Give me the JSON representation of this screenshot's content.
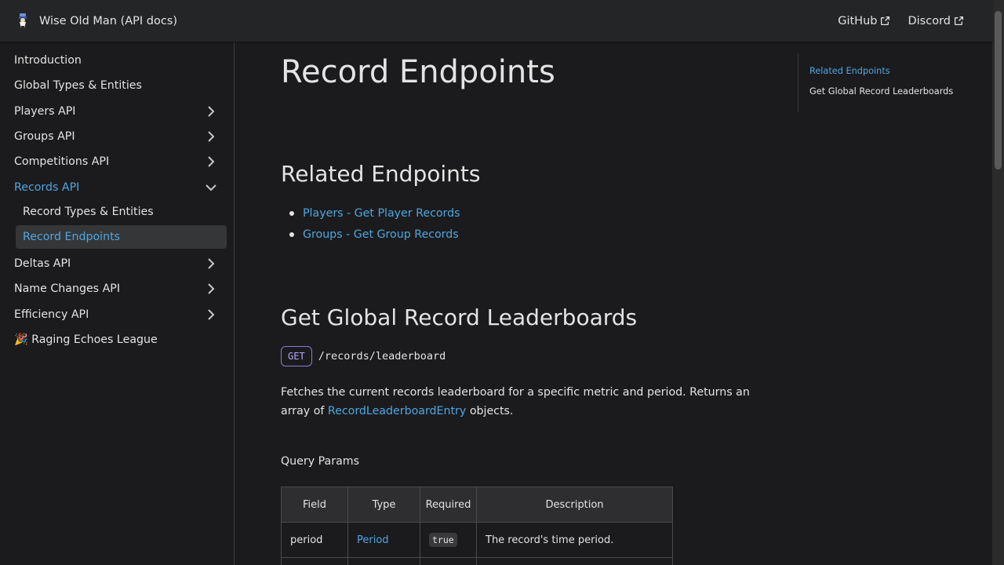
{
  "navbar": {
    "title": "Wise Old Man (API docs)",
    "links": [
      {
        "label": "GitHub",
        "icon": "external-link-icon"
      },
      {
        "label": "Discord",
        "icon": "external-link-icon"
      }
    ]
  },
  "sidebar": {
    "items": [
      {
        "label": "Introduction"
      },
      {
        "label": "Global Types & Entities"
      },
      {
        "label": "Players API",
        "icon": "chevron-right-icon"
      },
      {
        "label": "Groups API",
        "icon": "chevron-right-icon"
      },
      {
        "label": "Competitions API",
        "icon": "chevron-right-icon"
      },
      {
        "label": "Records API",
        "icon": "chevron-down-icon",
        "active": true
      },
      {
        "label": "Deltas API",
        "icon": "chevron-right-icon"
      },
      {
        "label": "Name Changes API",
        "icon": "chevron-right-icon"
      },
      {
        "label": "Efficiency API",
        "icon": "chevron-right-icon"
      },
      {
        "label": "🎉 Raging Echoes League"
      }
    ],
    "records_sub": [
      {
        "label": "Record Types & Entities"
      },
      {
        "label": "Record Endpoints",
        "current": true
      }
    ]
  },
  "main": {
    "title": "Record Endpoints",
    "related_heading": "Related Endpoints",
    "related_links": [
      {
        "label": "Players - Get Player Records"
      },
      {
        "label": "Groups - Get Group Records"
      }
    ],
    "endpoint_heading": "Get Global Record Leaderboards",
    "method": "GET",
    "path": "/records/leaderboard",
    "description_pre": "Fetches the current records leaderboard for a specific metric and period. Returns an array of",
    "description_link": "RecordLeaderboardEntry",
    "description_post": "objects.",
    "query_params_title": "Query Params",
    "table": {
      "headers": [
        "Field",
        "Type",
        "Required",
        "Description"
      ],
      "rows": [
        {
          "field": "period",
          "type": "Period",
          "required": "true",
          "description": "The record's time period."
        }
      ]
    }
  },
  "toc": {
    "items": [
      {
        "label": "Related Endpoints",
        "active": true
      },
      {
        "label": "Get Global Record Leaderboards",
        "active": false
      }
    ]
  },
  "colors": {
    "accent": "#4fa6e0",
    "background": "#1b1b1d",
    "navbar": "#242526",
    "method_badge": "#8c7ad6"
  }
}
